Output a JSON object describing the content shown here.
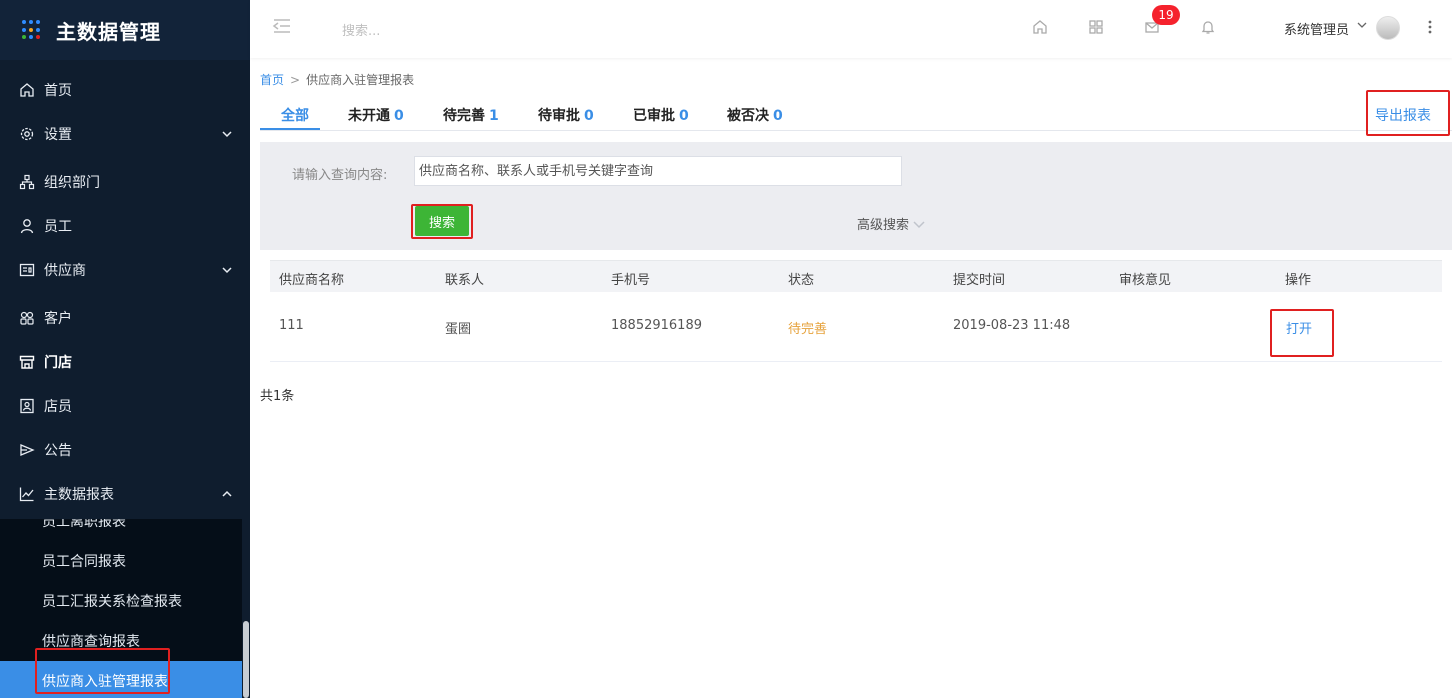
{
  "app": {
    "title": "主数据管理"
  },
  "sidebar": {
    "items": [
      {
        "label": "首页",
        "icon": "home-icon"
      },
      {
        "label": "设置",
        "icon": "gear-icon",
        "expandable": true
      },
      {
        "label": "组织部门",
        "icon": "org-icon"
      },
      {
        "label": "员工",
        "icon": "user-icon"
      },
      {
        "label": "供应商",
        "icon": "supplier-icon",
        "expandable": true
      },
      {
        "label": "客户",
        "icon": "customer-icon"
      },
      {
        "label": "门店",
        "icon": "store-icon"
      },
      {
        "label": "店员",
        "icon": "clerk-icon"
      },
      {
        "label": "公告",
        "icon": "announcement-icon"
      },
      {
        "label": "主数据报表",
        "icon": "chart-icon",
        "expanded": true
      }
    ],
    "subitems": [
      {
        "label": "员工离职报表"
      },
      {
        "label": "员工合同报表"
      },
      {
        "label": "员工汇报关系检查报表"
      },
      {
        "label": "供应商查询报表"
      },
      {
        "label": "供应商入驻管理报表",
        "active": true
      }
    ]
  },
  "topbar": {
    "search_placeholder": "搜索...",
    "notification_count": "19",
    "user_name": "系统管理员"
  },
  "breadcrumb": {
    "home": "首页",
    "separator": ">",
    "current": "供应商入驻管理报表"
  },
  "tabs": [
    {
      "label": "全部",
      "count": "",
      "active": true
    },
    {
      "label": "未开通",
      "count": "0"
    },
    {
      "label": "待完善",
      "count": "1"
    },
    {
      "label": "待审批",
      "count": "0"
    },
    {
      "label": "已审批",
      "count": "0"
    },
    {
      "label": "被否决",
      "count": "0"
    }
  ],
  "export_label": "导出报表",
  "filter": {
    "label": "请输入查询内容:",
    "placeholder": "供应商名称、联系人或手机号关键字查询",
    "search_button": "搜索",
    "advanced": "高级搜索"
  },
  "table": {
    "columns": [
      "供应商名称",
      "联系人",
      "手机号",
      "状态",
      "提交时间",
      "审核意见",
      "操作"
    ],
    "rows": [
      {
        "supplier": "111",
        "contact": "蛋圈",
        "phone": "18852916189",
        "status": "待完善",
        "submitted": "2019-08-23 11:48",
        "review": "",
        "action": "打开"
      }
    ]
  },
  "total": "共1条",
  "colors": {
    "sidebar_bg": "#0f1d2e",
    "accent": "#3a8ee6",
    "search_button": "#3db536",
    "status_pending": "#e6a23c",
    "highlight": "#e02020"
  }
}
